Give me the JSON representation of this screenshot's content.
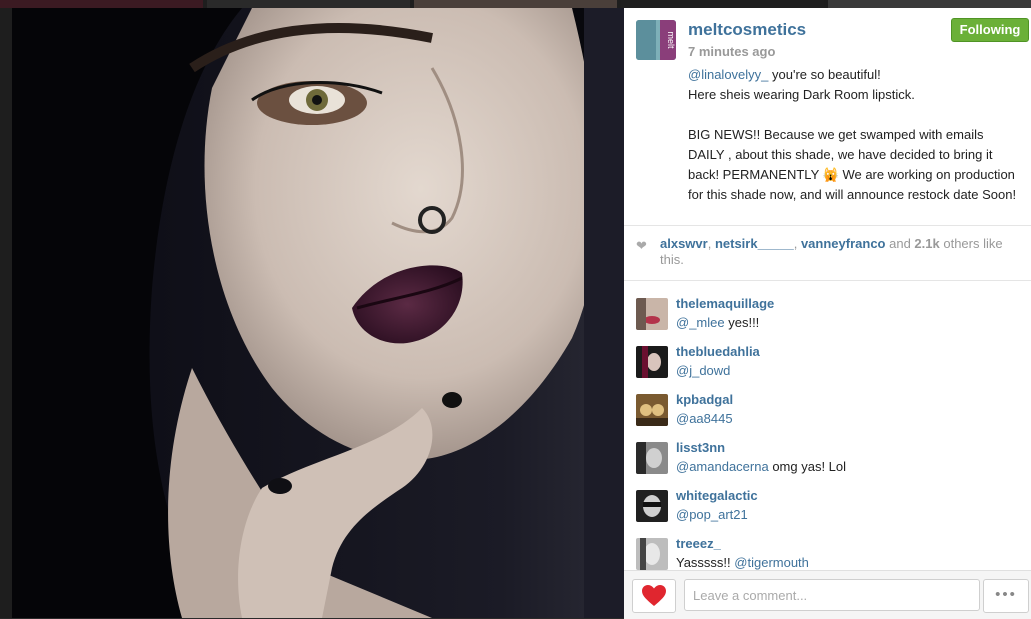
{
  "post": {
    "username": "meltcosmetics",
    "time": "7 minutes ago",
    "follow_label": "Following",
    "caption_mention": "@linalovelyy_",
    "caption_line1_rest": " you're so beautiful!",
    "caption_line2": "Here sheis wearing Dark Room lipstick.",
    "caption_news": "BIG NEWS!! Because we get swamped with emails DAILY , about this shade, we have decided to bring it back! PERMANENTLY",
    "caption_emoji": "🙀",
    "caption_news_end": " We are working on production for this shade now, and will announce restock date Soon!",
    "avatar_icon": "melt-logo-avatar"
  },
  "likes": {
    "user1": "alxswvr",
    "sep1": ", ",
    "user2": "netsirk_____",
    "sep2": ", ",
    "user3": "vanneyfranco",
    "and_text": " and ",
    "count": "2.1k",
    "rest": " others like this."
  },
  "comments": [
    {
      "user": "thelemaquillage",
      "mention": "@_mlee",
      "text": " yes!!!"
    },
    {
      "user": "thebluedahlia",
      "mention": "@j_dowd",
      "text": ""
    },
    {
      "user": "kpbadgal",
      "mention": "@aa8445",
      "text": ""
    },
    {
      "user": "lisst3nn",
      "mention": "@amandacerna",
      "text": " omg yas! Lol"
    },
    {
      "user": "whitegalactic",
      "mention": "@pop_art21",
      "text": ""
    },
    {
      "user": "treeez_",
      "prefix": "Yasssss!! ",
      "mention": "@tigermouth",
      "text": ""
    }
  ],
  "footer": {
    "comment_placeholder": "Leave a comment...",
    "more_label": "•••"
  },
  "colors": {
    "link": "#3f729b",
    "follow_green": "#6bb038",
    "like_red": "#e0262f"
  }
}
